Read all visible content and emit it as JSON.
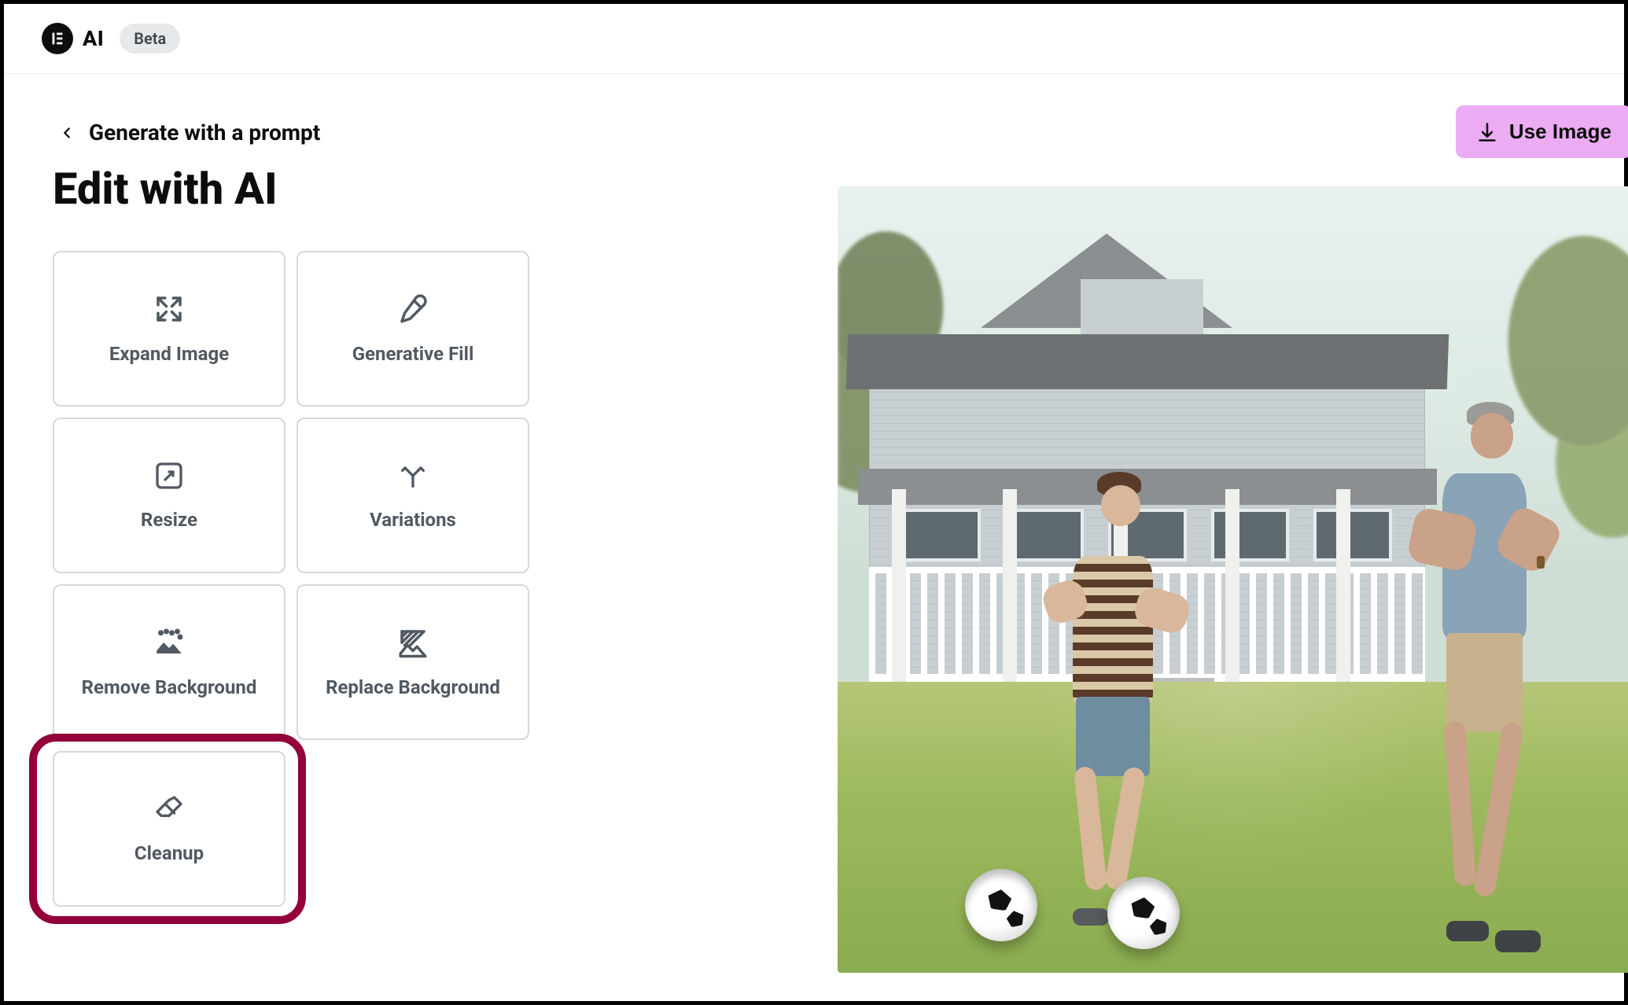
{
  "header": {
    "brand": "AI",
    "badge": "Beta"
  },
  "back": {
    "label": "Generate with a prompt"
  },
  "title": "Edit with AI",
  "tools": [
    {
      "key": "expand",
      "label": "Expand Image",
      "icon": "expand-icon"
    },
    {
      "key": "genfill",
      "label": "Generative Fill",
      "icon": "brush-icon"
    },
    {
      "key": "resize",
      "label": "Resize",
      "icon": "resize-icon"
    },
    {
      "key": "variations",
      "label": "Variations",
      "icon": "variations-icon"
    },
    {
      "key": "removebg",
      "label": "Remove Background",
      "icon": "remove-bg-icon"
    },
    {
      "key": "replacebg",
      "label": "Replace Background",
      "icon": "replace-bg-icon"
    },
    {
      "key": "cleanup",
      "label": "Cleanup",
      "icon": "eraser-icon",
      "highlighted": true
    }
  ],
  "actions": {
    "useImage": "Use Image"
  },
  "colors": {
    "primaryPink": "#ebacf3",
    "highlightRed": "#93003a",
    "iconGray": "#515962"
  },
  "preview": {
    "alt": "A man and a boy play soccer on a lawn in front of a light-gray house with a white porch; two soccer balls on the grass."
  }
}
